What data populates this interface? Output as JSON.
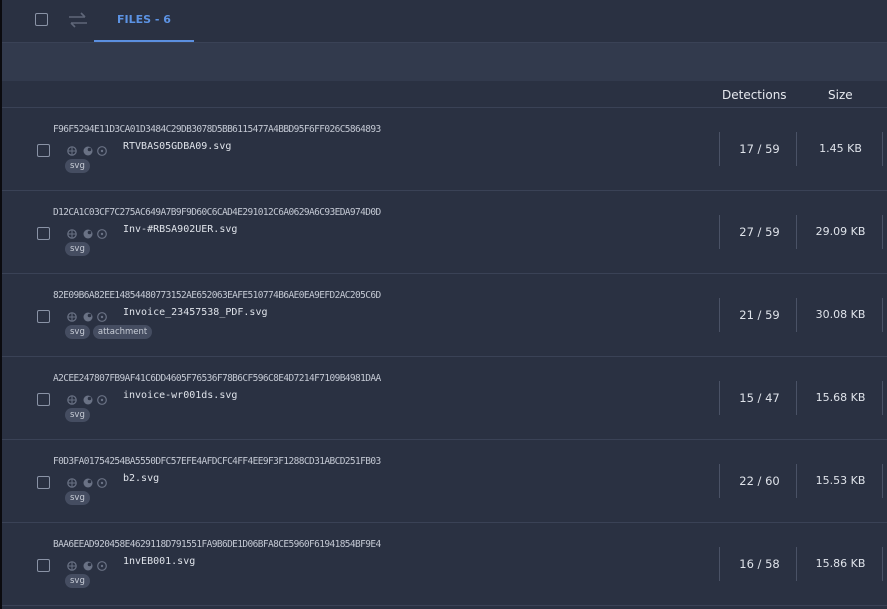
{
  "tabs": {
    "files_label": "FILES - 6"
  },
  "columns": {
    "detections": "Detections",
    "size": "Size"
  },
  "colors": {
    "accent": "#5b8fe0",
    "panel": "#2a3142",
    "tag_bg": "#454d61"
  },
  "files": [
    {
      "hash": "F96F5294E11D3CA01D3484C29DB3078D5BB6115477A4BBD95F6FF026C5864893",
      "name": "RTVBAS05GDBA09.svg",
      "tags": [
        "svg"
      ],
      "detections": "17 / 59",
      "size": "1.45 KB"
    },
    {
      "hash": "D12CA1C03CF7C275AC649A7B9F9D60C6CAD4E291012C6A0629A6C93EDA974D0D",
      "name": "Inv-#RBSA902UER.svg",
      "tags": [
        "svg"
      ],
      "detections": "27 / 59",
      "size": "29.09 KB"
    },
    {
      "hash": "82E09B6A82EE14854480773152AE652063EAFE510774B6AE0EA9EFD2AC205C6D",
      "name": "Invoice_23457538_PDF.svg",
      "tags": [
        "svg",
        "attachment"
      ],
      "detections": "21 / 59",
      "size": "30.08 KB"
    },
    {
      "hash": "A2CEE247807FB9AF41C6DD4605F76536F78B6CF596C8E4D7214F7109B4981DAA",
      "name": "invoice-wr001ds.svg",
      "tags": [
        "svg"
      ],
      "detections": "15 / 47",
      "size": "15.68 KB"
    },
    {
      "hash": "F0D3FA01754254BA5550DFC57EFE4AFDCFC4FF4EE9F3F1288CD31ABCD251FB03",
      "name": "b2.svg",
      "tags": [
        "svg"
      ],
      "detections": "22 / 60",
      "size": "15.53 KB"
    },
    {
      "hash": "BAA6EEAD920458E4629118D791551FA9B6DE1D06BFA8CE5960F61941854BF9E4",
      "name": "1nvEB001.svg",
      "tags": [
        "svg"
      ],
      "detections": "16 / 58",
      "size": "15.86 KB"
    }
  ]
}
